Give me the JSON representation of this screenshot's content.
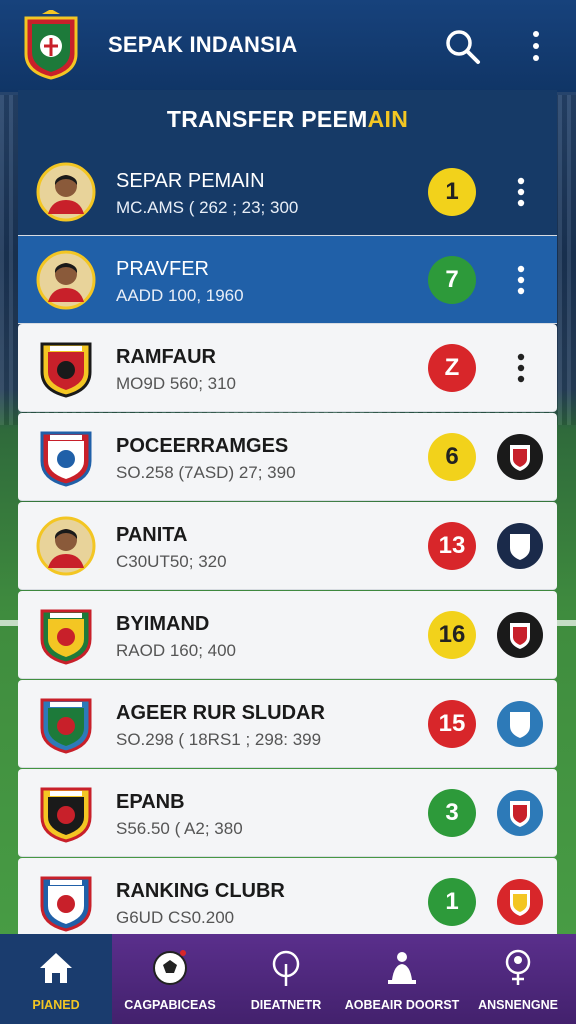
{
  "header": {
    "title": "SEPAK INDANSIA",
    "logo": "club-crest-logo",
    "search_icon": "search-icon",
    "more_icon": "more-vertical-icon"
  },
  "section": {
    "title_main": "TRANSFER PEEM",
    "title_accent": "AIN",
    "accent_color": "#f3c623"
  },
  "rows": [
    {
      "name": "SEPAR PEMAIN",
      "sub": "MC.AMS  ( 262 ; 23; 300",
      "number": "1",
      "number_color": "yellow",
      "style": "dark",
      "thumb": "player-photo",
      "trailing": "kebab"
    },
    {
      "name": "PRAVFER",
      "sub": "AADD 100,  1960",
      "number": "7",
      "number_color": "green",
      "style": "blue",
      "thumb": "player-photo",
      "trailing": "kebab"
    },
    {
      "name": "RAMFAUR",
      "sub": "MO9D 560;   310",
      "number": "Z",
      "number_color": "red",
      "style": "light",
      "thumb": "club-crest",
      "trailing": "kebab"
    },
    {
      "name": "POCEERRAMGES",
      "sub": "SO.258  (7ASD)  27; 390",
      "number": "6",
      "number_color": "yellow",
      "style": "light",
      "thumb": "club-crest",
      "trailing": "club-badge"
    },
    {
      "name": "PANITA",
      "sub": "C30UT50;   320",
      "number": "13",
      "number_color": "red",
      "style": "light",
      "thumb": "player-photo",
      "trailing": "club-badge"
    },
    {
      "name": "BYIMAND",
      "sub": "RAOD 160;   400",
      "number": "16",
      "number_color": "yellow",
      "style": "light",
      "thumb": "club-crest",
      "trailing": "club-badge"
    },
    {
      "name": "AGEER RUR SLUDAR",
      "sub": "SO.298  ( 18RS1 ; 298: 399",
      "number": "15",
      "number_color": "red",
      "style": "light",
      "thumb": "club-crest",
      "trailing": "club-badge"
    },
    {
      "name": "EPANB",
      "sub": "S56.50  ( A2;   380",
      "number": "3",
      "number_color": "green",
      "style": "light",
      "thumb": "club-crest",
      "trailing": "club-badge"
    },
    {
      "name": "RANKING CLUBR",
      "sub": "G6UD CS0.200",
      "number": "1",
      "number_color": "green",
      "style": "light",
      "thumb": "club-crest",
      "trailing": "club-badge"
    }
  ],
  "nav": [
    {
      "label": "PIANED",
      "icon": "home-icon",
      "active": true
    },
    {
      "label": "CAGPABICEAS",
      "icon": "soccer-ball-icon",
      "active": false
    },
    {
      "label": "DIEATNETR",
      "icon": "location-pin-icon",
      "active": false
    },
    {
      "label": "AOBEAIR DOORST",
      "icon": "player-icon",
      "active": false
    },
    {
      "label": "ANSNENGNE",
      "icon": "user-badge-icon",
      "active": false
    }
  ]
}
